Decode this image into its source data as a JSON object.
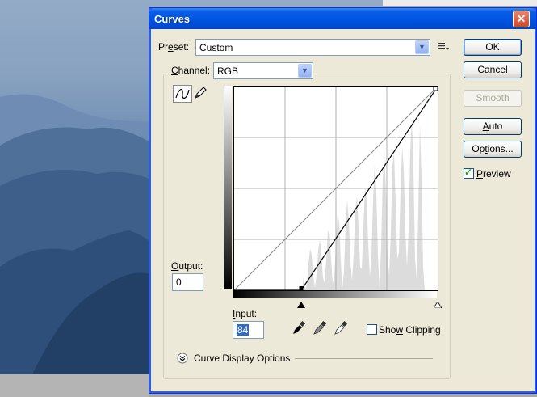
{
  "dialog": {
    "title": "Curves",
    "close_label": "✕"
  },
  "preset": {
    "label_pre": "Pr",
    "label_u": "e",
    "label_post": "set:",
    "value": "Custom"
  },
  "channel": {
    "label_u": "C",
    "label_post": "hannel:",
    "value": "RGB"
  },
  "output": {
    "label_u": "O",
    "label_post": "utput:",
    "value": "0"
  },
  "input": {
    "label_u": "I",
    "label_post": "nput:",
    "value": "84"
  },
  "buttons": {
    "ok": "OK",
    "cancel": "Cancel",
    "smooth": "Smooth",
    "auto_u": "A",
    "auto_post": "uto",
    "options_pre": "Op",
    "options_u": "t",
    "options_post": "ions..."
  },
  "preview": {
    "label_u": "P",
    "label_post": "review",
    "checked": true
  },
  "show_clipping": {
    "label_pre": "Sho",
    "label_u": "w",
    "label_post": " Clipping",
    "checked": false
  },
  "curve_display": {
    "label": "Curve Display Options"
  },
  "icons": {
    "preset_menu": "list-menu-icon",
    "curve_tool": "curve-icon",
    "pencil_tool": "pencil-icon",
    "eyedroppers": [
      "black-eyedropper-icon",
      "gray-eyedropper-icon",
      "white-eyedropper-icon"
    ],
    "expand": "chevron-down-circle-icon"
  },
  "curve": {
    "input_black_point": 84,
    "output_black_point": 0,
    "input_white_point": 255,
    "output_white_point": 255
  },
  "colors": {
    "titlebar": "#0054e3",
    "dialog_bg": "#ece9d8",
    "selection": "#316ac5"
  }
}
